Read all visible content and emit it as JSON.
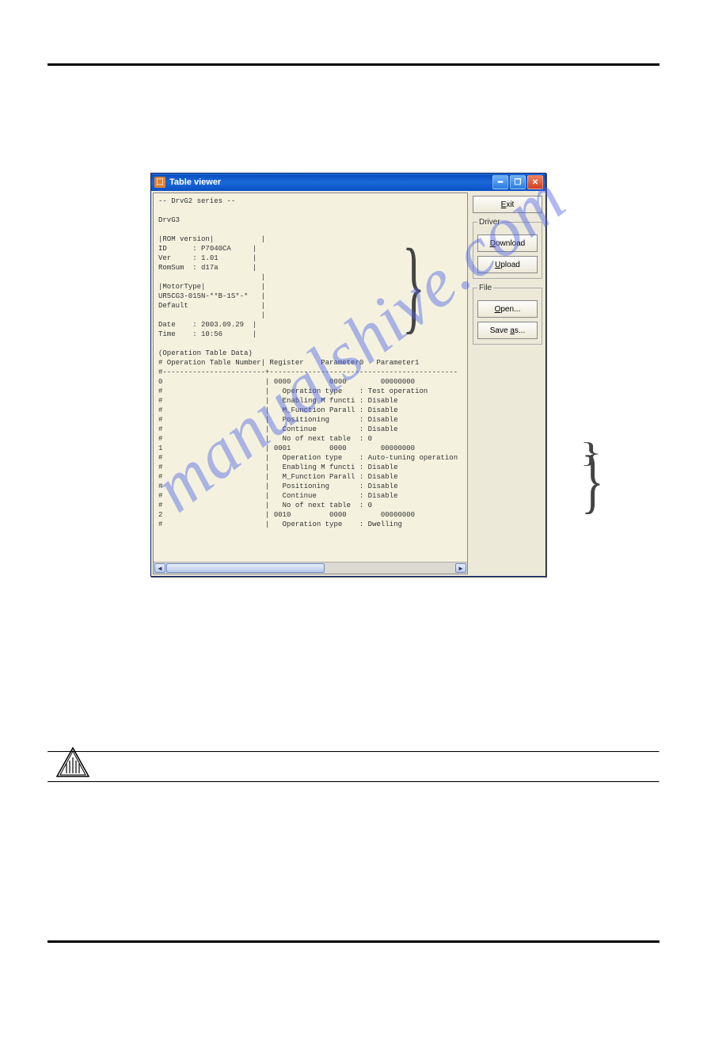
{
  "window": {
    "title": "Table viewer"
  },
  "buttons": {
    "exit": "Exit",
    "download": "Download",
    "upload": "Upload",
    "open": "Open...",
    "saveas": "Save as..."
  },
  "groups": {
    "driver": "Driver",
    "file": "File"
  },
  "text": {
    "header": "-- DrvG2 series --",
    "model": "DrvG3",
    "romsection": "|ROM version|",
    "id_l": "ID",
    "id_v": "P7040CA",
    "ver_l": "Ver",
    "ver_v": "1.01",
    "romsum_l": "RomSum",
    "romsum_v": "d17a",
    "motortype": "|MotorType|",
    "motor": "UR5CG3-015N-**B-1S*-*",
    "def": "Default",
    "date_l": "Date",
    "date_v": "2003.09.29",
    "time_l": "Time",
    "time_v": "10:56",
    "opdata": "(Operation Table Data)",
    "opheader": "# Operation Table Number| Register    Parameter0   Parameter1",
    "rule": "#------------------------+--------------------------------------------",
    "t0_reg": "0000",
    "t0_p0": "0000",
    "t0_p1": "00000000",
    "t0_type": "Test operation",
    "enm": "Enabling M functi",
    "mf": "M_Function Parall",
    "pos": "Positioning",
    "cont": "Continue",
    "next": "No of next table",
    "disable": "Disable",
    "zero": "0",
    "t1_reg": "0001",
    "t1_p0": "0000",
    "t1_p1": "00000000",
    "t1_type": "Auto-tuning operation",
    "t2_reg": "0010",
    "t2_p0": "0000",
    "t2_p1": "00000000",
    "t2_type": "Dwelling",
    "op": "Operation type"
  },
  "watermark": "manualshive.com"
}
